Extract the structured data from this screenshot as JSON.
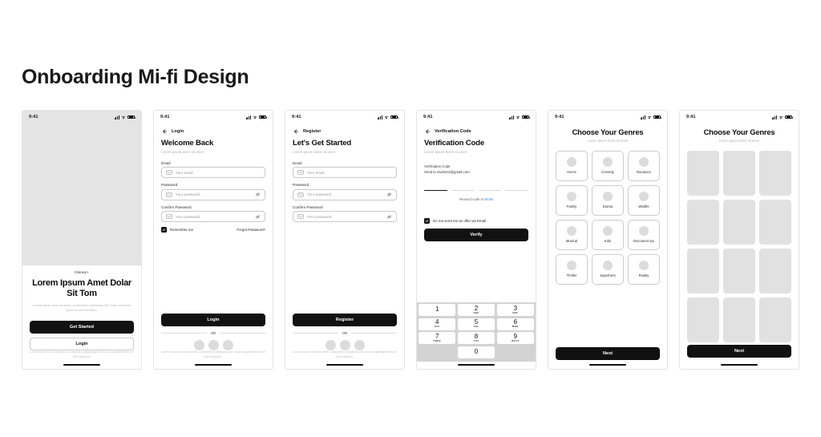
{
  "page": {
    "title": "Onboarding Mi-fi Design",
    "background": "#ffffff",
    "accent_dark": "#111111",
    "accent_blue": "#2f80ed",
    "placeholder_grey": "#e1e1e1"
  },
  "status_bar": {
    "time": "9:41",
    "icons": [
      "signal-icon",
      "wifi-icon",
      "battery-icon"
    ]
  },
  "legal_text": "Lorem ipsum dolor sit amet, consectetur adipiscing elit. Nunc vulputate libero et velit interdum.",
  "screens": [
    {
      "id": "splash",
      "brand": "Disney+",
      "title": "Lorem Ipsum Amet Dolar Sit Tom",
      "description": "Lorem ipsum dolor sit amet, consectetur adipiscing elit. Nunc vulputate libero et velit interdum.",
      "primary_button": "Get Started",
      "secondary_button": "Login",
      "footer": "Lorem ipsum dolor sit amet, consectetur adipiscing elit. Nunc vulputate libero et velit interdum."
    },
    {
      "id": "login",
      "nav_title": "Login",
      "heading": "Welcome Back",
      "subheading": "Lorem ipsum dolor sit amet",
      "fields": [
        {
          "label": "Email",
          "placeholder": "Your email",
          "has_eye": false
        },
        {
          "label": "Password",
          "placeholder": "Your password",
          "has_eye": true
        },
        {
          "label": "Confirm Password",
          "placeholder": "Your password",
          "has_eye": true
        }
      ],
      "remember_label": "Remember me",
      "forgot_label": "Forgot Password?",
      "submit_button": "Login",
      "divider": "OR",
      "footer": "Lorem ipsum dolor sit amet, consectetur adipiscing elit. Nunc vulputate libero et velit interdum."
    },
    {
      "id": "register",
      "nav_title": "Register",
      "heading": "Let's Get Started",
      "subheading": "Lorem ipsum dolor sit amet",
      "fields": [
        {
          "label": "Email",
          "placeholder": "Your email",
          "has_eye": false
        },
        {
          "label": "Password",
          "placeholder": "Your password",
          "has_eye": true
        },
        {
          "label": "Confirm Password",
          "placeholder": "Your password",
          "has_eye": true
        }
      ],
      "submit_button": "Register",
      "divider": "OR",
      "footer": "Lorem ipsum dolor sit amet, consectetur adipiscing elit. Nunc vulputate libero et velit interdum."
    },
    {
      "id": "verification",
      "nav_title": "Verification Code",
      "heading": "Verification Code",
      "subheading": "Lorem ipsum dolor sit amet",
      "info_line1": "Verification Code",
      "info_line2": "Send to ulvetnick@gmail.com",
      "resend_prefix": "Resend code in ",
      "resend_timer": "00:56",
      "offer_checkbox_label": "Do not send me an offer via Email",
      "verify_button": "Verify",
      "keypad": [
        {
          "num": "1",
          "sub": ""
        },
        {
          "num": "2",
          "sub": "ABC"
        },
        {
          "num": "3",
          "sub": "DEF"
        },
        {
          "num": "4",
          "sub": "GHI"
        },
        {
          "num": "5",
          "sub": "JKL"
        },
        {
          "num": "6",
          "sub": "MNO"
        },
        {
          "num": "7",
          "sub": "PQRS"
        },
        {
          "num": "8",
          "sub": "TUV"
        },
        {
          "num": "9",
          "sub": "WXYZ"
        },
        {
          "num": "0",
          "sub": ""
        }
      ]
    },
    {
      "id": "genres",
      "heading": "Choose Your Genres",
      "subheading": "Lorem ipsum dolor sit amet",
      "genres": [
        "Horror",
        "Comedy",
        "Romance",
        "Family",
        "Drama",
        "Wildlife",
        "Musical",
        "Kids",
        "Document ary",
        "Thriller",
        "Superhero",
        "Reality"
      ],
      "next_button": "Next"
    },
    {
      "id": "genres_posters",
      "heading": "Choose Your Genres",
      "subheading": "Lorem ipsum dolor sit amet",
      "poster_count": 12,
      "next_button": "Next"
    }
  ]
}
